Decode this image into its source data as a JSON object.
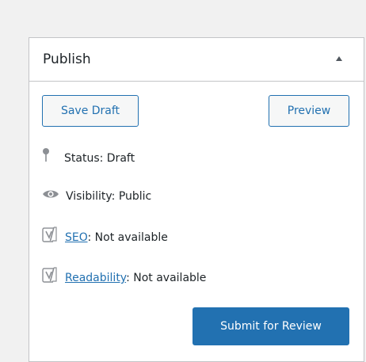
{
  "publish_box": {
    "title": "Publish",
    "toggle_icon": "arrow-up-icon",
    "save_draft_label": "Save Draft",
    "preview_label": "Preview",
    "status": {
      "icon": "pin-icon",
      "text": "Status: Draft"
    },
    "visibility": {
      "icon": "eye-icon",
      "text": "Visibility: Public"
    },
    "seo": {
      "icon": "yoast-icon",
      "link": "SEO",
      "text": ": Not available"
    },
    "readability": {
      "icon": "yoast-icon",
      "link": "Readability",
      "text": ": Not available"
    },
    "submit_label": "Submit for Review"
  },
  "colors": {
    "accent": "#2271b1",
    "border": "#c3c4c7",
    "background": "#f1f1f1",
    "text": "#1d2327",
    "icon": "#8c8f94"
  }
}
